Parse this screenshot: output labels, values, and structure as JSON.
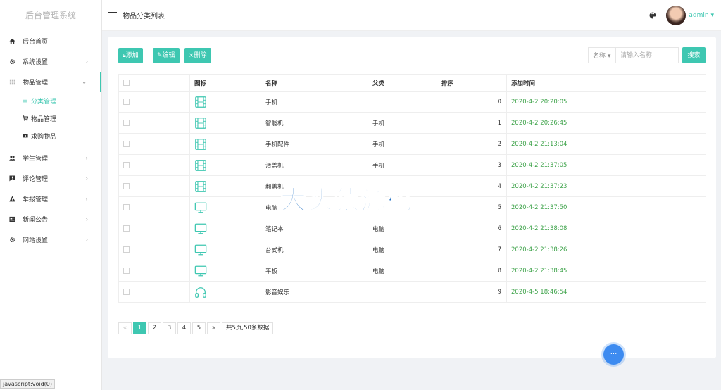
{
  "app_title": "后台管理系统",
  "header": {
    "page_title": "物品分类列表",
    "user": "admin ▾"
  },
  "sidebar": {
    "items": [
      {
        "label": "后台首页"
      },
      {
        "label": "系统设置"
      },
      {
        "label": "物品管理"
      },
      {
        "label": "学生管理"
      },
      {
        "label": "评论管理"
      },
      {
        "label": "举报管理"
      },
      {
        "label": "新闻公告"
      },
      {
        "label": "网站设置"
      }
    ],
    "submenu": [
      {
        "label": "分类管理"
      },
      {
        "label": "物品管理"
      },
      {
        "label": "求购物品"
      }
    ]
  },
  "toolbar": {
    "add": "添加",
    "edit": "编辑",
    "delete": "删除"
  },
  "search": {
    "field": "名称 ▾",
    "placeholder": "请输入名称",
    "button": "搜索"
  },
  "table": {
    "headers": [
      "图标",
      "名称",
      "父类",
      "排序",
      "添加时间"
    ],
    "rows": [
      {
        "icon": "film-icon",
        "name": "手机",
        "parent": "",
        "order": "0",
        "time": "2020-4-2 20:20:05"
      },
      {
        "icon": "film-icon",
        "name": "智能机",
        "parent": "手机",
        "order": "1",
        "time": "2020-4-2 20:26:45"
      },
      {
        "icon": "film-icon",
        "name": "手机配件",
        "parent": "手机",
        "order": "2",
        "time": "2020-4-2 21:13:04"
      },
      {
        "icon": "film-icon",
        "name": "滑盖机",
        "parent": "手机",
        "order": "3",
        "time": "2020-4-2 21:37:05"
      },
      {
        "icon": "film-icon",
        "name": "翻盖机",
        "parent": "",
        "order": "4",
        "time": "2020-4-2 21:37:23"
      },
      {
        "icon": "monitor-icon",
        "name": "电脑",
        "parent": "",
        "order": "5",
        "time": "2020-4-2 21:37:50"
      },
      {
        "icon": "monitor-icon",
        "name": "笔记本",
        "parent": "电脑",
        "order": "6",
        "time": "2020-4-2 21:38:08"
      },
      {
        "icon": "monitor-icon",
        "name": "台式机",
        "parent": "电脑",
        "order": "7",
        "time": "2020-4-2 21:38:26"
      },
      {
        "icon": "monitor-icon",
        "name": "平板",
        "parent": "电脑",
        "order": "8",
        "time": "2020-4-2 21:38:45"
      },
      {
        "icon": "headphones-icon",
        "name": "影音娱乐",
        "parent": "",
        "order": "9",
        "time": "2020-4-5 18:46:54"
      }
    ]
  },
  "pagination": {
    "prev": "«",
    "pages": [
      "1",
      "2",
      "3",
      "4",
      "5"
    ],
    "next": "»",
    "summary": "共5页,50条数据"
  },
  "watermark": "大头猿源码",
  "status_tip": "javascript:void(0)",
  "colors": {
    "accent": "#3ec7b1",
    "time": "#3ea34a",
    "watermark": "#1e6fc4"
  }
}
